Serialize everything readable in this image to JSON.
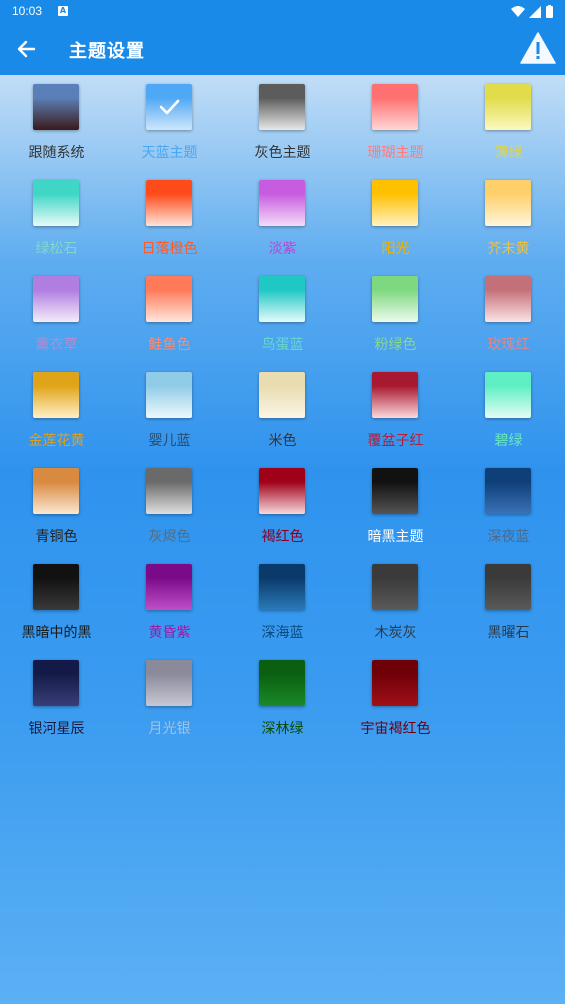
{
  "status_bar": {
    "time": "10:03",
    "notification_icon": "a-box-icon",
    "signal_icons": [
      "wifi-icon",
      "cell-signal-icon",
      "battery-icon"
    ]
  },
  "app_bar": {
    "title": "主题设置",
    "back_icon": "arrow-left-icon",
    "action_icon": "warning-icon"
  },
  "themes": [
    {
      "label": "跟随系统",
      "label_color": "#333333",
      "top": "#5b7fb8",
      "bottom": "#3a1a1a",
      "selected": false
    },
    {
      "label": "天蓝主题",
      "label_color": "#4aa6ee",
      "top": "#4fa8f5",
      "bottom": "#cfe6fb",
      "selected": true
    },
    {
      "label": "灰色主题",
      "label_color": "#333333",
      "top": "#5c5c5c",
      "bottom": "#e8e8e8",
      "selected": false
    },
    {
      "label": "珊瑚主题",
      "label_color": "#ff7b7b",
      "top": "#ff7070",
      "bottom": "#ffd7d7",
      "selected": false
    },
    {
      "label": "薄绿",
      "label_color": "#d8d45a",
      "top": "#e0dc4a",
      "bottom": "#fbf8c0",
      "selected": false
    },
    {
      "label": "绿松石",
      "label_color": "#7ed8cc",
      "top": "#3fd6c5",
      "bottom": "#e8fbf8",
      "selected": false
    },
    {
      "label": "日落橙色",
      "label_color": "#ff5a2a",
      "top": "#ff4a1a",
      "bottom": "#ffe4d8",
      "selected": false
    },
    {
      "label": "淡紫",
      "label_color": "#b04ad6",
      "top": "#c85ce0",
      "bottom": "#f3dcf8",
      "selected": false
    },
    {
      "label": "阳光",
      "label_color": "#f0b400",
      "top": "#ffc000",
      "bottom": "#fff3c0",
      "selected": false
    },
    {
      "label": "芥末黄",
      "label_color": "#f0c040",
      "top": "#ffcf6a",
      "bottom": "#fff6dc",
      "selected": false
    },
    {
      "label": "薰衣草",
      "label_color": "#a890d8",
      "top": "#b07ee0",
      "bottom": "#f4ecfb",
      "selected": false
    },
    {
      "label": "鲑鱼色",
      "label_color": "#ff8a6a",
      "top": "#ff7a58",
      "bottom": "#ffe6dc",
      "selected": false
    },
    {
      "label": "鸟蛋蓝",
      "label_color": "#6ad6d0",
      "top": "#20c8c4",
      "bottom": "#e4fbfa",
      "selected": false
    },
    {
      "label": "粉绿色",
      "label_color": "#88d888",
      "top": "#7ed880",
      "bottom": "#ecfbec",
      "selected": false
    },
    {
      "label": "玫瑰红",
      "label_color": "#d88a90",
      "top": "#c47078",
      "bottom": "#fbe4e6",
      "selected": false
    },
    {
      "label": "金莲花黄",
      "label_color": "#e0a020",
      "top": "#e0a418",
      "bottom": "#fff0c8",
      "selected": false
    },
    {
      "label": "婴儿蓝",
      "label_color": "#2a4a6a",
      "top": "#90cce8",
      "bottom": "#eef8fc",
      "selected": false
    },
    {
      "label": "米色",
      "label_color": "#333333",
      "top": "#e8dcb0",
      "bottom": "#fbf6e6",
      "selected": false
    },
    {
      "label": "覆盆子红",
      "label_color": "#b0203a",
      "top": "#a81830",
      "bottom": "#fbd8dc",
      "selected": false
    },
    {
      "label": "碧绿",
      "label_color": "#6ae8c0",
      "top": "#5ef0c4",
      "bottom": "#e4fbf4",
      "selected": false
    },
    {
      "label": "青铜色",
      "label_color": "#222222",
      "top": "#d88a40",
      "bottom": "#fbe8d0",
      "selected": false
    },
    {
      "label": "灰烬色",
      "label_color": "#5a6a78",
      "top": "#6a6a6a",
      "bottom": "#e0e0e0",
      "selected": false
    },
    {
      "label": "褐红色",
      "label_color": "#8a0020",
      "top": "#a00018",
      "bottom": "#f8d8dc",
      "selected": false
    },
    {
      "label": "暗黑主题",
      "label_color": "#ffffff",
      "top": "#111111",
      "bottom": "#555555",
      "selected": false
    },
    {
      "label": "深夜蓝",
      "label_color": "#4a6a90",
      "top": "#0f3f78",
      "bottom": "#3a72b8",
      "selected": false
    },
    {
      "label": "黑暗中的黑",
      "label_color": "#1a1a1a",
      "top": "#111111",
      "bottom": "#3a3a3a",
      "selected": false
    },
    {
      "label": "黄昏紫",
      "label_color": "#9a1aa8",
      "top": "#7a0a88",
      "bottom": "#c050c8",
      "selected": false
    },
    {
      "label": "深海蓝",
      "label_color": "#0a4a7a",
      "top": "#0a3a6a",
      "bottom": "#2a7ab8",
      "selected": false
    },
    {
      "label": "木炭灰",
      "label_color": "#2a3a4a",
      "top": "#3a3a3a",
      "bottom": "#5a5a5a",
      "selected": false
    },
    {
      "label": "黑曜石",
      "label_color": "#2a3a4a",
      "top": "#3a3a3a",
      "bottom": "#5a5a5a",
      "selected": false
    },
    {
      "label": "银河星辰",
      "label_color": "#1a1a3a",
      "top": "#141a48",
      "bottom": "#3a3e78",
      "selected": false
    },
    {
      "label": "月光银",
      "label_color": "#a8c0d8",
      "top": "#8a8a9a",
      "bottom": "#c8c8d4",
      "selected": false
    },
    {
      "label": "深林绿",
      "label_color": "#0a4a0a",
      "top": "#0a6010",
      "bottom": "#1a8a2a",
      "selected": false
    },
    {
      "label": "宇宙褐红色",
      "label_color": "#6a0010",
      "top": "#700008",
      "bottom": "#a01018",
      "selected": false
    }
  ]
}
